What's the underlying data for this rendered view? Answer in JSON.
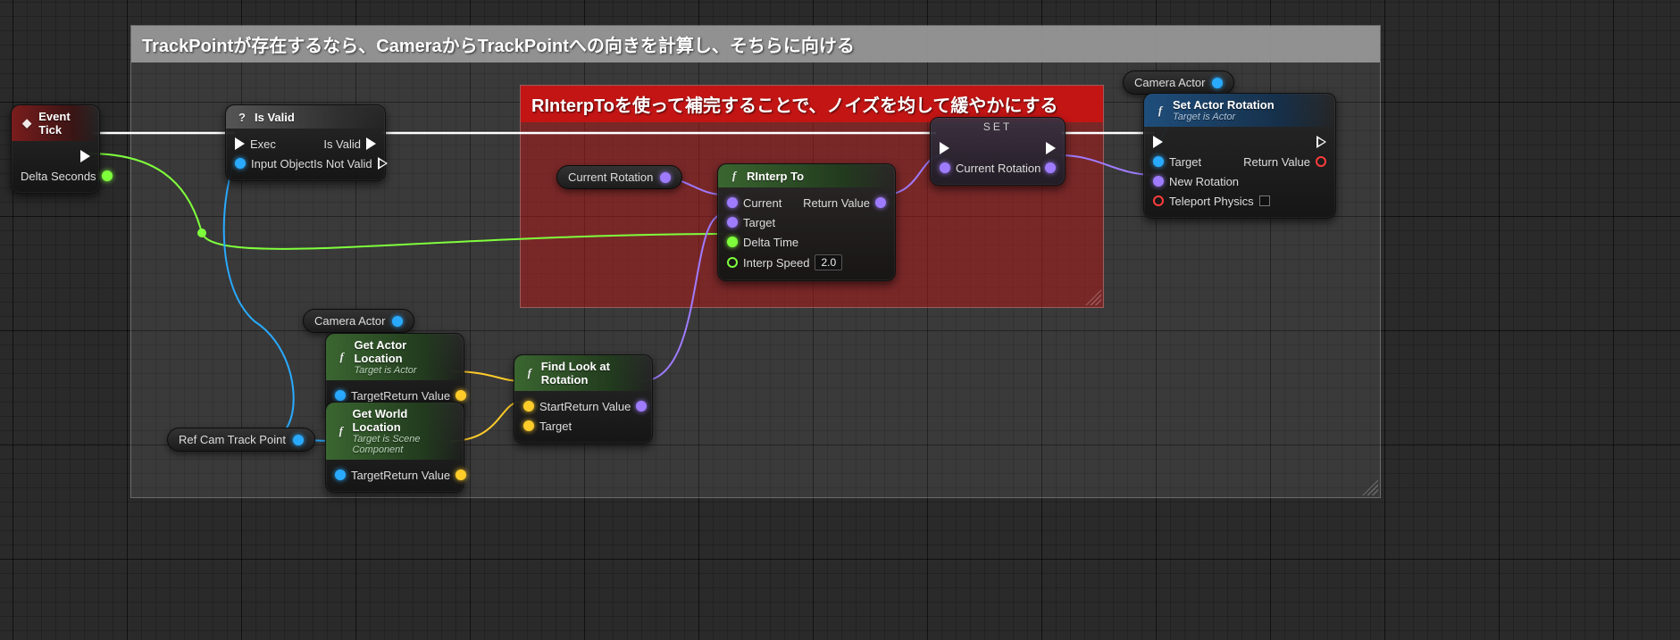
{
  "comments": {
    "main_label": "TrackPointが存在するなら、CameraからTrackPointへの向きを計算し、そちらに向ける",
    "red_label": "RInterpToを使って補完することで、ノイズを均して緩やかにする"
  },
  "nodes": {
    "event_tick": {
      "title": "Event Tick",
      "out_delta": "Delta Seconds"
    },
    "is_valid": {
      "title": "Is Valid",
      "in_exec": "Exec",
      "in_obj": "Input Object",
      "out_valid": "Is Valid",
      "out_notvalid": "Is Not Valid"
    },
    "camera_actor_top": "Camera Actor",
    "camera_actor_mid": "Camera Actor",
    "ref_track_point": "Ref Cam Track Point",
    "current_rotation_var": "Current Rotation",
    "get_actor_location": {
      "title": "Get Actor Location",
      "subtitle": "Target is Actor",
      "in_target": "Target",
      "out": "Return Value"
    },
    "get_world_location": {
      "title": "Get World Location",
      "subtitle": "Target is Scene Component",
      "in_target": "Target",
      "out": "Return Value"
    },
    "find_look_at": {
      "title": "Find Look at Rotation",
      "in_start": "Start",
      "in_target": "Target",
      "out": "Return Value"
    },
    "rinterp": {
      "title": "RInterp To",
      "in_current": "Current",
      "in_target": "Target",
      "in_delta": "Delta Time",
      "in_speed": "Interp Speed",
      "speed_value": "2.0",
      "out": "Return Value"
    },
    "set_rot_var": {
      "title": "SET",
      "var": "Current Rotation"
    },
    "set_actor_rotation": {
      "title": "Set Actor Rotation",
      "subtitle": "Target is Actor",
      "in_target": "Target",
      "in_newrot": "New Rotation",
      "in_teleport": "Teleport Physics",
      "out": "Return Value"
    }
  }
}
